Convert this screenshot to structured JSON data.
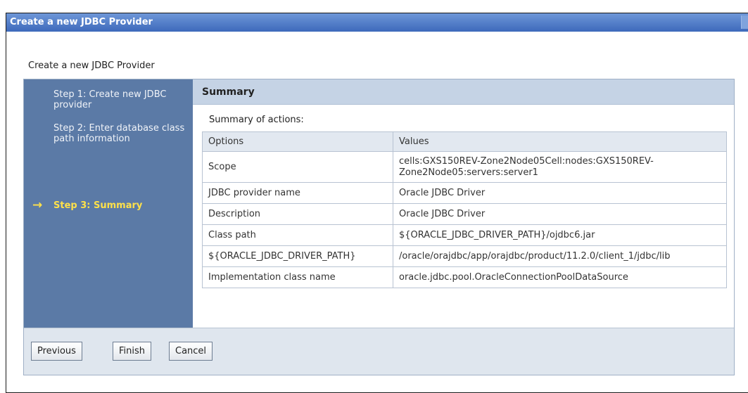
{
  "window": {
    "title": "Create a new JDBC Provider"
  },
  "page": {
    "heading": "Create a new JDBC Provider"
  },
  "steps": [
    {
      "label": "Step 1: Create new JDBC provider",
      "current": false
    },
    {
      "label": "Step 2: Enter database class path information",
      "current": false
    },
    {
      "label": "Step 3: Summary",
      "current": true
    }
  ],
  "current_step_marker": "→",
  "summary": {
    "title": "Summary",
    "actions_label": "Summary of actions:",
    "columns": [
      "Options",
      "Values"
    ],
    "rows": [
      {
        "option": "Scope",
        "value": "cells:GXS150REV-Zone2Node05Cell:nodes:GXS150REV-Zone2Node05:servers:server1"
      },
      {
        "option": "JDBC provider name",
        "value": "Oracle JDBC Driver"
      },
      {
        "option": "Description",
        "value": "Oracle JDBC Driver"
      },
      {
        "option": "Class path",
        "value": "${ORACLE_JDBC_DRIVER_PATH}/ojdbc6.jar"
      },
      {
        "option": "${ORACLE_JDBC_DRIVER_PATH}",
        "value": "/oracle/orajdbc/app/orajdbc/product/11.2.0/client_1/jdbc/lib"
      },
      {
        "option": "Implementation class name",
        "value": "oracle.jdbc.pool.OracleConnectionPoolDataSource"
      }
    ]
  },
  "buttons": {
    "previous": "Previous",
    "finish": "Finish",
    "cancel": "Cancel"
  },
  "colors": {
    "title_bar": "#3d69bb",
    "steps_panel": "#5b7aa6",
    "current_step": "#ffe14a",
    "summary_header": "#c5d3e5"
  }
}
